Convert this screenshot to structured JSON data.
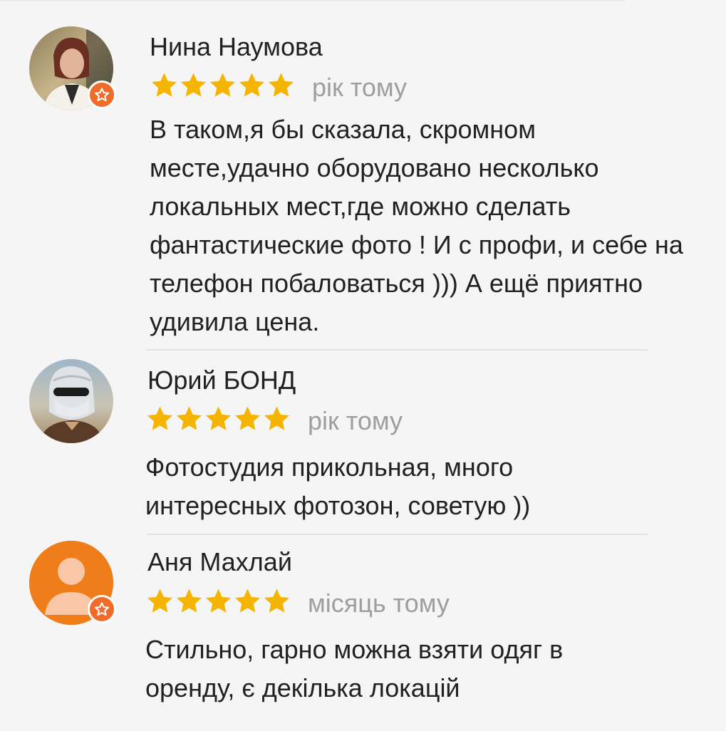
{
  "reviews": [
    {
      "author": "Нина Наумова",
      "rating": 5,
      "date": "рік тому",
      "text": "В таком,я бы сказала, скромном месте,удачно оборудовано несколько локальных мест,где можно сделать фантастические фото ! И с профи, и себе на телефон побаловаться ))) А ещё приятно удивила цена.",
      "local_guide": true,
      "avatar": "photo-avatar-woman"
    },
    {
      "author": "Юрий БОНД",
      "rating": 5,
      "date": "рік тому",
      "text": "Фотостудия прикольная, много интересных фотозон, советую ))",
      "local_guide": false,
      "avatar": "photo-avatar-man-sunglasses"
    },
    {
      "author": "Аня Махлай",
      "rating": 5,
      "date": "місяць тому",
      "text": "Стильно, гарно можна взяти одяг в оренду, є декілька локацій",
      "local_guide": true,
      "avatar": "default-person-avatar"
    }
  ],
  "colors": {
    "star": "#f4b400",
    "badge": "#ef6c2a",
    "default_avatar": "#ef7d1a",
    "date": "#9e9e9e",
    "text": "#212121",
    "background": "#f5f5f5"
  }
}
